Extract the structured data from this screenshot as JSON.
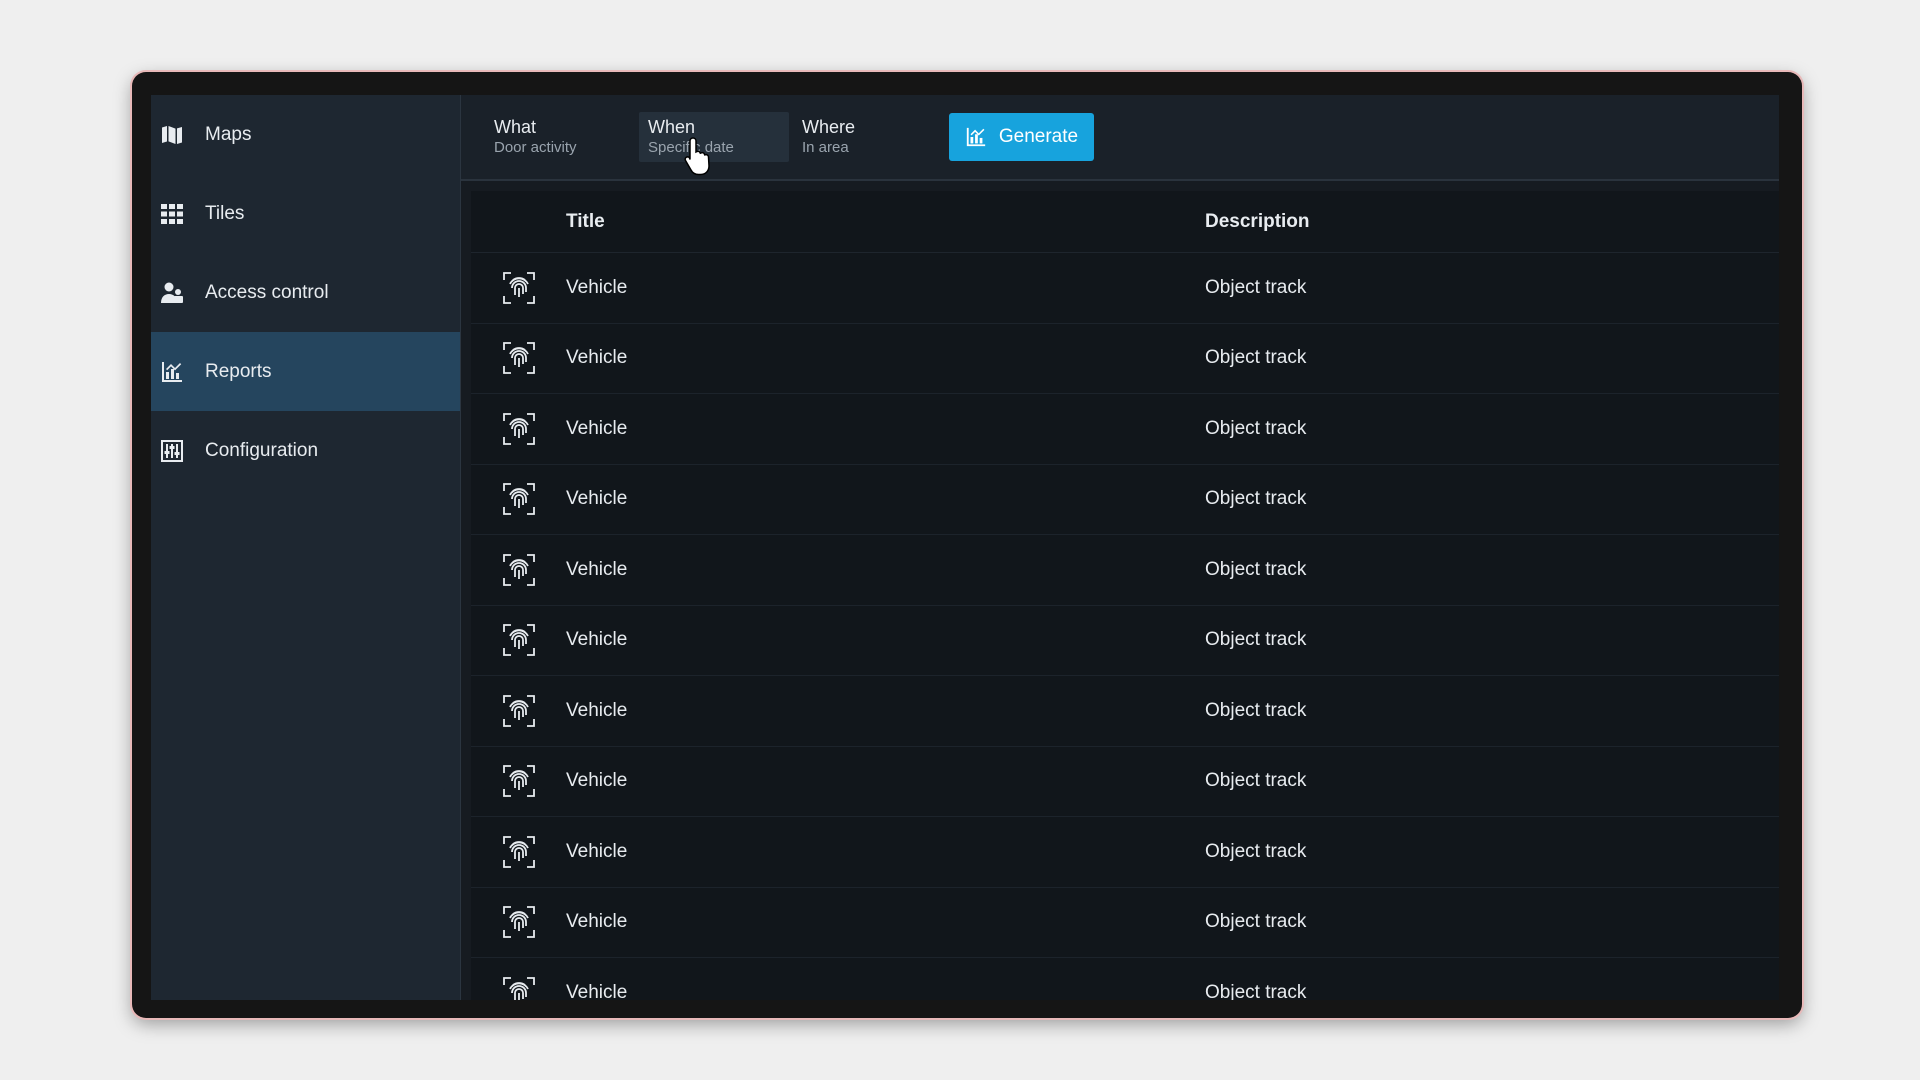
{
  "sidebar": {
    "items": [
      {
        "label": "Maps",
        "icon": "map-icon"
      },
      {
        "label": "Tiles",
        "icon": "grid-icon"
      },
      {
        "label": "Access control",
        "icon": "people-icon"
      },
      {
        "label": "Reports",
        "icon": "chart-icon",
        "active": true
      },
      {
        "label": "Configuration",
        "icon": "config-icon"
      }
    ]
  },
  "filters": {
    "what": {
      "title": "What",
      "sub": "Door activity"
    },
    "when": {
      "title": "When",
      "sub": "Specific date"
    },
    "where": {
      "title": "Where",
      "sub": "In area"
    },
    "generate_label": "Generate"
  },
  "table": {
    "headers": {
      "title": "Title",
      "description": "Description"
    },
    "rows": [
      {
        "title": "Vehicle",
        "description": "Object track",
        "icon": "fingerprint-icon"
      },
      {
        "title": "Vehicle",
        "description": "Object track",
        "icon": "fingerprint-icon"
      },
      {
        "title": "Vehicle",
        "description": "Object track",
        "icon": "fingerprint-icon"
      },
      {
        "title": "Vehicle",
        "description": "Object track",
        "icon": "fingerprint-icon"
      },
      {
        "title": "Vehicle",
        "description": "Object track",
        "icon": "fingerprint-icon"
      },
      {
        "title": "Vehicle",
        "description": "Object track",
        "icon": "fingerprint-icon"
      },
      {
        "title": "Vehicle",
        "description": "Object track",
        "icon": "fingerprint-icon"
      },
      {
        "title": "Vehicle",
        "description": "Object track",
        "icon": "fingerprint-icon"
      },
      {
        "title": "Vehicle",
        "description": "Object track",
        "icon": "fingerprint-icon"
      },
      {
        "title": "Vehicle",
        "description": "Object track",
        "icon": "fingerprint-icon"
      },
      {
        "title": "Vehicle",
        "description": "Object track",
        "icon": "fingerprint-icon"
      }
    ]
  },
  "colors": {
    "accent": "#17a3dd",
    "sidebar_active": "#25455e",
    "sidebar_bg": "#1e2731",
    "table_bg": "#11161b"
  }
}
